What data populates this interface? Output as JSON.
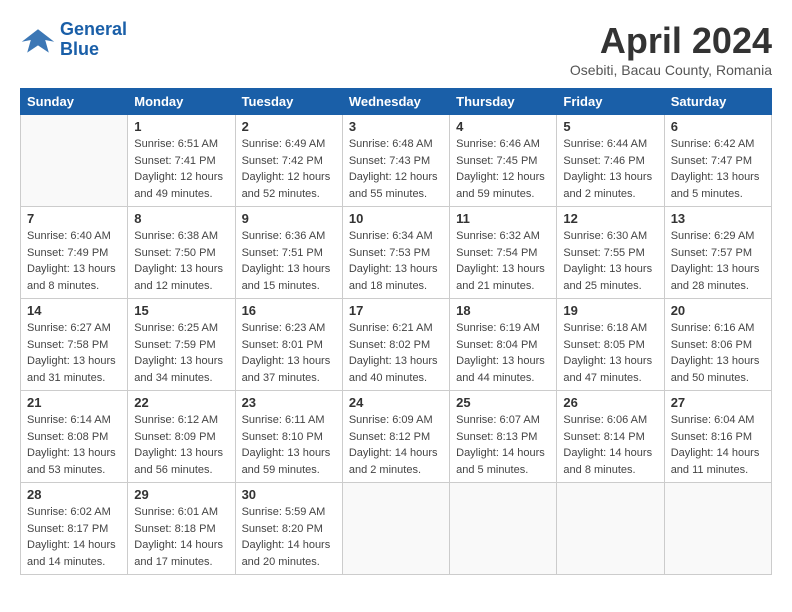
{
  "logo": {
    "line1": "General",
    "line2": "Blue"
  },
  "title": "April 2024",
  "subtitle": "Osebiti, Bacau County, Romania",
  "weekdays": [
    "Sunday",
    "Monday",
    "Tuesday",
    "Wednesday",
    "Thursday",
    "Friday",
    "Saturday"
  ],
  "weeks": [
    [
      {
        "day": "",
        "sunrise": "",
        "sunset": "",
        "daylight": ""
      },
      {
        "day": "1",
        "sunrise": "Sunrise: 6:51 AM",
        "sunset": "Sunset: 7:41 PM",
        "daylight": "Daylight: 12 hours and 49 minutes."
      },
      {
        "day": "2",
        "sunrise": "Sunrise: 6:49 AM",
        "sunset": "Sunset: 7:42 PM",
        "daylight": "Daylight: 12 hours and 52 minutes."
      },
      {
        "day": "3",
        "sunrise": "Sunrise: 6:48 AM",
        "sunset": "Sunset: 7:43 PM",
        "daylight": "Daylight: 12 hours and 55 minutes."
      },
      {
        "day": "4",
        "sunrise": "Sunrise: 6:46 AM",
        "sunset": "Sunset: 7:45 PM",
        "daylight": "Daylight: 12 hours and 59 minutes."
      },
      {
        "day": "5",
        "sunrise": "Sunrise: 6:44 AM",
        "sunset": "Sunset: 7:46 PM",
        "daylight": "Daylight: 13 hours and 2 minutes."
      },
      {
        "day": "6",
        "sunrise": "Sunrise: 6:42 AM",
        "sunset": "Sunset: 7:47 PM",
        "daylight": "Daylight: 13 hours and 5 minutes."
      }
    ],
    [
      {
        "day": "7",
        "sunrise": "Sunrise: 6:40 AM",
        "sunset": "Sunset: 7:49 PM",
        "daylight": "Daylight: 13 hours and 8 minutes."
      },
      {
        "day": "8",
        "sunrise": "Sunrise: 6:38 AM",
        "sunset": "Sunset: 7:50 PM",
        "daylight": "Daylight: 13 hours and 12 minutes."
      },
      {
        "day": "9",
        "sunrise": "Sunrise: 6:36 AM",
        "sunset": "Sunset: 7:51 PM",
        "daylight": "Daylight: 13 hours and 15 minutes."
      },
      {
        "day": "10",
        "sunrise": "Sunrise: 6:34 AM",
        "sunset": "Sunset: 7:53 PM",
        "daylight": "Daylight: 13 hours and 18 minutes."
      },
      {
        "day": "11",
        "sunrise": "Sunrise: 6:32 AM",
        "sunset": "Sunset: 7:54 PM",
        "daylight": "Daylight: 13 hours and 21 minutes."
      },
      {
        "day": "12",
        "sunrise": "Sunrise: 6:30 AM",
        "sunset": "Sunset: 7:55 PM",
        "daylight": "Daylight: 13 hours and 25 minutes."
      },
      {
        "day": "13",
        "sunrise": "Sunrise: 6:29 AM",
        "sunset": "Sunset: 7:57 PM",
        "daylight": "Daylight: 13 hours and 28 minutes."
      }
    ],
    [
      {
        "day": "14",
        "sunrise": "Sunrise: 6:27 AM",
        "sunset": "Sunset: 7:58 PM",
        "daylight": "Daylight: 13 hours and 31 minutes."
      },
      {
        "day": "15",
        "sunrise": "Sunrise: 6:25 AM",
        "sunset": "Sunset: 7:59 PM",
        "daylight": "Daylight: 13 hours and 34 minutes."
      },
      {
        "day": "16",
        "sunrise": "Sunrise: 6:23 AM",
        "sunset": "Sunset: 8:01 PM",
        "daylight": "Daylight: 13 hours and 37 minutes."
      },
      {
        "day": "17",
        "sunrise": "Sunrise: 6:21 AM",
        "sunset": "Sunset: 8:02 PM",
        "daylight": "Daylight: 13 hours and 40 minutes."
      },
      {
        "day": "18",
        "sunrise": "Sunrise: 6:19 AM",
        "sunset": "Sunset: 8:04 PM",
        "daylight": "Daylight: 13 hours and 44 minutes."
      },
      {
        "day": "19",
        "sunrise": "Sunrise: 6:18 AM",
        "sunset": "Sunset: 8:05 PM",
        "daylight": "Daylight: 13 hours and 47 minutes."
      },
      {
        "day": "20",
        "sunrise": "Sunrise: 6:16 AM",
        "sunset": "Sunset: 8:06 PM",
        "daylight": "Daylight: 13 hours and 50 minutes."
      }
    ],
    [
      {
        "day": "21",
        "sunrise": "Sunrise: 6:14 AM",
        "sunset": "Sunset: 8:08 PM",
        "daylight": "Daylight: 13 hours and 53 minutes."
      },
      {
        "day": "22",
        "sunrise": "Sunrise: 6:12 AM",
        "sunset": "Sunset: 8:09 PM",
        "daylight": "Daylight: 13 hours and 56 minutes."
      },
      {
        "day": "23",
        "sunrise": "Sunrise: 6:11 AM",
        "sunset": "Sunset: 8:10 PM",
        "daylight": "Daylight: 13 hours and 59 minutes."
      },
      {
        "day": "24",
        "sunrise": "Sunrise: 6:09 AM",
        "sunset": "Sunset: 8:12 PM",
        "daylight": "Daylight: 14 hours and 2 minutes."
      },
      {
        "day": "25",
        "sunrise": "Sunrise: 6:07 AM",
        "sunset": "Sunset: 8:13 PM",
        "daylight": "Daylight: 14 hours and 5 minutes."
      },
      {
        "day": "26",
        "sunrise": "Sunrise: 6:06 AM",
        "sunset": "Sunset: 8:14 PM",
        "daylight": "Daylight: 14 hours and 8 minutes."
      },
      {
        "day": "27",
        "sunrise": "Sunrise: 6:04 AM",
        "sunset": "Sunset: 8:16 PM",
        "daylight": "Daylight: 14 hours and 11 minutes."
      }
    ],
    [
      {
        "day": "28",
        "sunrise": "Sunrise: 6:02 AM",
        "sunset": "Sunset: 8:17 PM",
        "daylight": "Daylight: 14 hours and 14 minutes."
      },
      {
        "day": "29",
        "sunrise": "Sunrise: 6:01 AM",
        "sunset": "Sunset: 8:18 PM",
        "daylight": "Daylight: 14 hours and 17 minutes."
      },
      {
        "day": "30",
        "sunrise": "Sunrise: 5:59 AM",
        "sunset": "Sunset: 8:20 PM",
        "daylight": "Daylight: 14 hours and 20 minutes."
      },
      {
        "day": "",
        "sunrise": "",
        "sunset": "",
        "daylight": ""
      },
      {
        "day": "",
        "sunrise": "",
        "sunset": "",
        "daylight": ""
      },
      {
        "day": "",
        "sunrise": "",
        "sunset": "",
        "daylight": ""
      },
      {
        "day": "",
        "sunrise": "",
        "sunset": "",
        "daylight": ""
      }
    ]
  ]
}
